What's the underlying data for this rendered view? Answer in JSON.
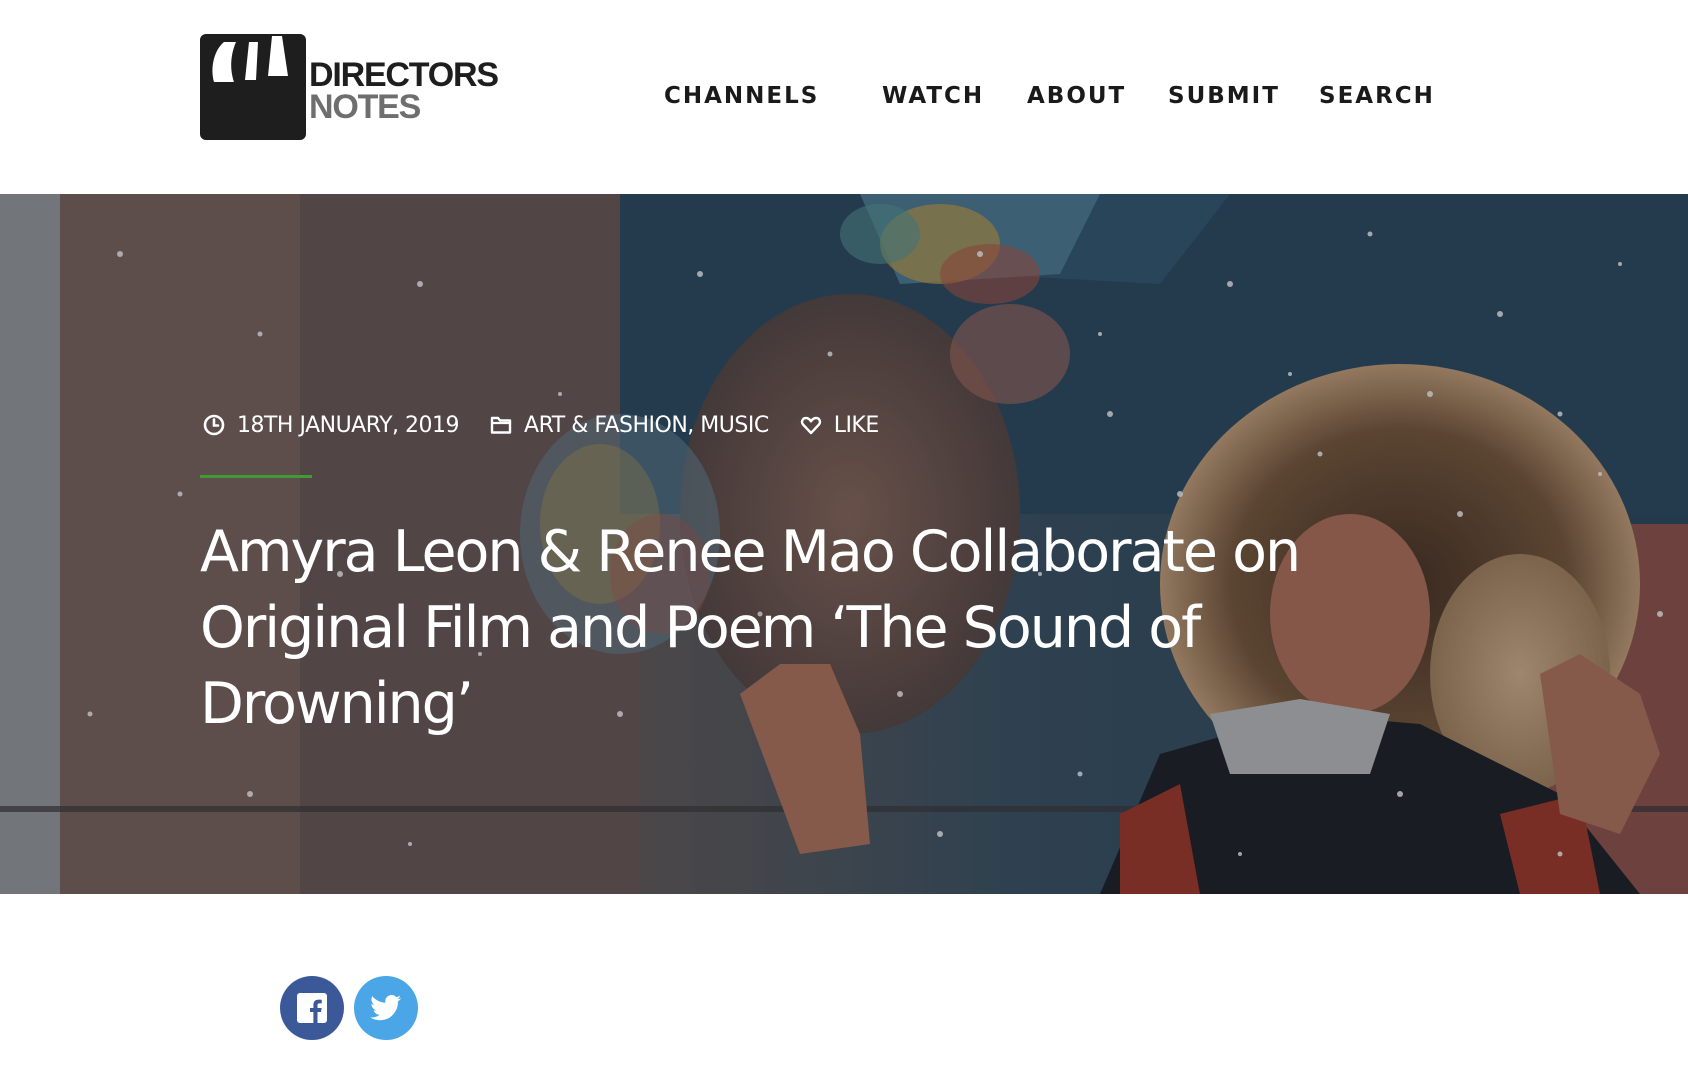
{
  "brand": {
    "line1": "DIRECTORS",
    "line2": "NOTES"
  },
  "nav": {
    "items": [
      {
        "label": "CHANNELS"
      },
      {
        "label": "WATCH"
      },
      {
        "label": "ABOUT"
      },
      {
        "label": "SUBMIT"
      },
      {
        "label": "SEARCH"
      }
    ]
  },
  "article": {
    "date": "18TH JANUARY, 2019",
    "categories": "ART & FASHION, MUSIC",
    "like_label": "LIKE",
    "title": "Amyra Leon & Renee Mao Collaborate on Original Film and Poem ‘The Sound of Drowning’"
  },
  "icons": {
    "date": "clock-icon",
    "categories": "folder-icon",
    "like": "heart-icon",
    "facebook": "facebook-icon",
    "twitter": "twitter-icon"
  },
  "colors": {
    "accent": "#3f9c35",
    "facebook": "#3b5998",
    "twitter": "#4aa6e6",
    "nav_text": "#1a1a1a"
  }
}
